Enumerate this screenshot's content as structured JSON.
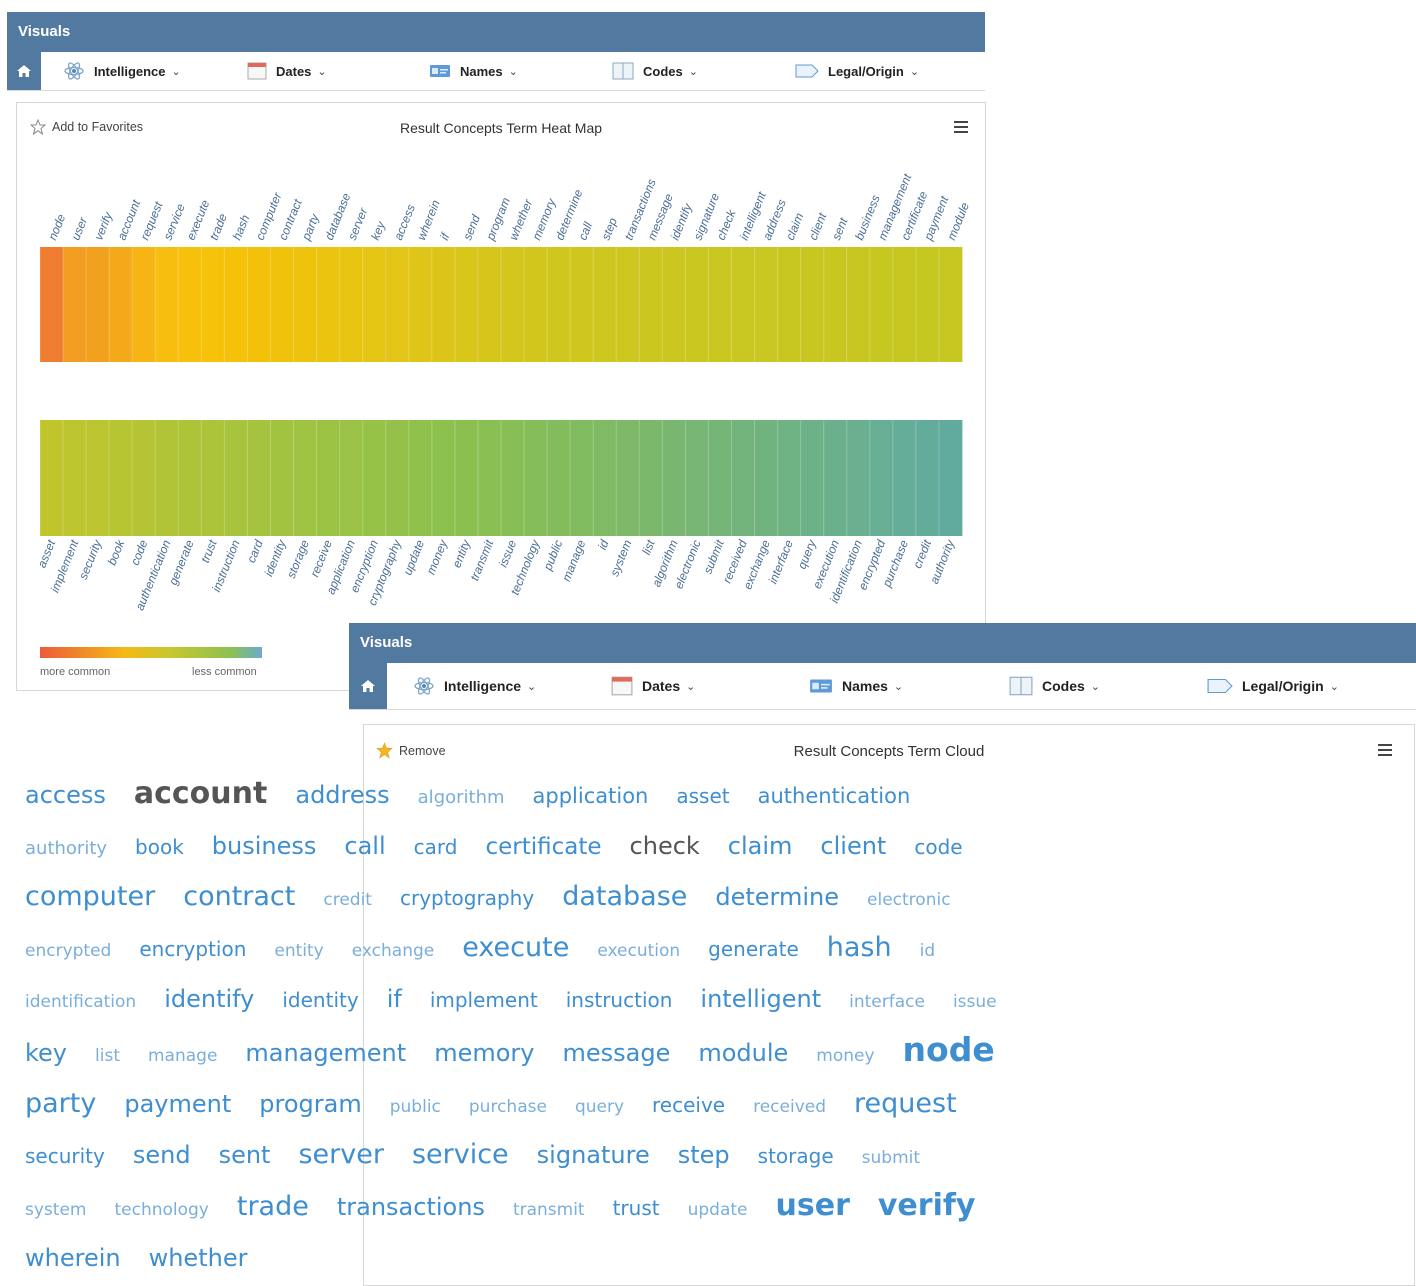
{
  "heatmap_window": {
    "title": "Visuals",
    "nav": [
      {
        "label": "Intelligence",
        "icon": "atom-icon"
      },
      {
        "label": "Dates",
        "icon": "calendar-icon"
      },
      {
        "label": "Names",
        "icon": "id-card-icon"
      },
      {
        "label": "Codes",
        "icon": "book-icon"
      },
      {
        "label": "Legal/Origin",
        "icon": "tag-icon"
      }
    ],
    "favorite_label": "Add to Favorites",
    "card_title": "Result Concepts Term Heat Map",
    "legend": {
      "left": "more common",
      "right": "less common"
    }
  },
  "chart_data": {
    "type": "heatmap",
    "title": "Result Concepts Term Heat Map",
    "rows": [
      {
        "terms": [
          "node",
          "user",
          "verify",
          "account",
          "request",
          "service",
          "execute",
          "trade",
          "hash",
          "computer",
          "contract",
          "party",
          "database",
          "server",
          "key",
          "access",
          "wherein",
          "if",
          "send",
          "program",
          "whether",
          "memory",
          "determine",
          "call",
          "step",
          "transactions",
          "message",
          "identify",
          "signature",
          "check",
          "intelligent",
          "address",
          "claim",
          "client",
          "sent",
          "business",
          "management",
          "certificate",
          "payment",
          "module"
        ],
        "colors": [
          "#ef7d31",
          "#f29d22",
          "#f2a11e",
          "#f4a91b",
          "#f6b515",
          "#f7bd0f",
          "#f7c10b",
          "#f7c20a",
          "#f6c109",
          "#f4c10a",
          "#f1c20c",
          "#eec30e",
          "#ebc410",
          "#e8c412",
          "#e5c514",
          "#e2c516",
          "#dfc517",
          "#dcc518",
          "#d9c61a",
          "#d6c61b",
          "#d4c61c",
          "#d2c61d",
          "#d0c71e",
          "#cfc71e",
          "#cec71f",
          "#cdc71f",
          "#ccc720",
          "#cbc720",
          "#cac720",
          "#cac721",
          "#c9c721",
          "#c9c721",
          "#c8c721",
          "#c8c722",
          "#c8c722",
          "#c8c722",
          "#c7c722",
          "#c7c722",
          "#c7c722",
          "#c7c722"
        ]
      },
      {
        "terms": [
          "asset",
          "implement",
          "security",
          "book",
          "code",
          "authentication",
          "generate",
          "trust",
          "instruction",
          "card",
          "identity",
          "storage",
          "receive",
          "application",
          "encryption",
          "cryptography",
          "update",
          "money",
          "entity",
          "transmit",
          "issue",
          "technology",
          "public",
          "manage",
          "id",
          "system",
          "list",
          "algorithm",
          "electronic",
          "submit",
          "received",
          "exchange",
          "interface",
          "query",
          "execution",
          "identification",
          "encrypted",
          "purchase",
          "credit",
          "authority"
        ],
        "colors": [
          "#c0c52b",
          "#bdc52e",
          "#bac530",
          "#b7c532",
          "#b4c434",
          "#b1c436",
          "#aec438",
          "#abc43a",
          "#a8c33c",
          "#a5c33e",
          "#a2c340",
          "#9fc342",
          "#9cc244",
          "#99c246",
          "#96c248",
          "#93c14a",
          "#90c14c",
          "#8dc14e",
          "#8bc050",
          "#89bf53",
          "#87be56",
          "#85bd59",
          "#83bc5c",
          "#81bb60",
          "#7fba64",
          "#7db968",
          "#7bb86c",
          "#79b770",
          "#77b674",
          "#75b578",
          "#73b47c",
          "#71b380",
          "#6fb284",
          "#6db188",
          "#6bb08c",
          "#69af90",
          "#67ae94",
          "#65ad98",
          "#63ac9b",
          "#61ab9e"
        ]
      }
    ],
    "legend": {
      "low": "more common",
      "high": "less common"
    }
  },
  "cloud_window": {
    "title": "Visuals",
    "nav": [
      {
        "label": "Intelligence",
        "icon": "atom-icon"
      },
      {
        "label": "Dates",
        "icon": "calendar-icon"
      },
      {
        "label": "Names",
        "icon": "id-card-icon"
      },
      {
        "label": "Codes",
        "icon": "book-icon"
      },
      {
        "label": "Legal/Origin",
        "icon": "tag-icon"
      }
    ],
    "favorite_label": "Remove",
    "card_title": "Result Concepts Term Cloud",
    "words": [
      {
        "text": "access",
        "size": 24,
        "color": "#3e8ed0",
        "bold": false
      },
      {
        "text": "account",
        "size": 30,
        "color": "#555555",
        "bold": true
      },
      {
        "text": "address",
        "size": 24,
        "color": "#3e8ed0",
        "bold": false
      },
      {
        "text": "algorithm",
        "size": 18,
        "color": "#7aaedb",
        "bold": false
      },
      {
        "text": "application",
        "size": 21,
        "color": "#3e8ed0",
        "bold": false
      },
      {
        "text": "asset",
        "size": 20,
        "color": "#3e8ed0",
        "bold": false
      },
      {
        "text": "authentication",
        "size": 21,
        "color": "#3e8ed0",
        "bold": false
      },
      {
        "text": "authority",
        "size": 18,
        "color": "#7aaedb",
        "bold": false
      },
      {
        "text": "book",
        "size": 20,
        "color": "#3e8ed0",
        "bold": false
      },
      {
        "text": "business",
        "size": 24,
        "color": "#3e8ed0",
        "bold": false
      },
      {
        "text": "call",
        "size": 24,
        "color": "#3e8ed0",
        "bold": false
      },
      {
        "text": "card",
        "size": 20,
        "color": "#3e8ed0",
        "bold": false
      },
      {
        "text": "certificate",
        "size": 23,
        "color": "#3e8ed0",
        "bold": false
      },
      {
        "text": "check",
        "size": 24,
        "color": "#555555",
        "bold": false
      },
      {
        "text": "claim",
        "size": 24,
        "color": "#3e8ed0",
        "bold": false
      },
      {
        "text": "client",
        "size": 24,
        "color": "#3e8ed0",
        "bold": false
      },
      {
        "text": "code",
        "size": 20,
        "color": "#3e8ed0",
        "bold": false
      },
      {
        "text": "computer",
        "size": 27,
        "color": "#3e8ed0",
        "bold": false
      },
      {
        "text": "contract",
        "size": 27,
        "color": "#3e8ed0",
        "bold": false
      },
      {
        "text": "credit",
        "size": 17,
        "color": "#7aaedb",
        "bold": false
      },
      {
        "text": "cryptography",
        "size": 20,
        "color": "#3e8ed0",
        "bold": false
      },
      {
        "text": "database",
        "size": 27,
        "color": "#3e8ed0",
        "bold": false
      },
      {
        "text": "determine",
        "size": 24,
        "color": "#3e8ed0",
        "bold": false
      },
      {
        "text": "electronic",
        "size": 17,
        "color": "#7aaedb",
        "bold": false
      },
      {
        "text": "encrypted",
        "size": 17,
        "color": "#7aaedb",
        "bold": false
      },
      {
        "text": "encryption",
        "size": 20,
        "color": "#3e8ed0",
        "bold": false
      },
      {
        "text": "entity",
        "size": 17,
        "color": "#7aaedb",
        "bold": false
      },
      {
        "text": "exchange",
        "size": 17,
        "color": "#7aaedb",
        "bold": false
      },
      {
        "text": "execute",
        "size": 27,
        "color": "#3e8ed0",
        "bold": false
      },
      {
        "text": "execution",
        "size": 17,
        "color": "#7aaedb",
        "bold": false
      },
      {
        "text": "generate",
        "size": 20,
        "color": "#3e8ed0",
        "bold": false
      },
      {
        "text": "hash",
        "size": 27,
        "color": "#3e8ed0",
        "bold": false
      },
      {
        "text": "id",
        "size": 17,
        "color": "#7aaedb",
        "bold": false
      },
      {
        "text": "identification",
        "size": 17,
        "color": "#7aaedb",
        "bold": false
      },
      {
        "text": "identify",
        "size": 24,
        "color": "#3e8ed0",
        "bold": false
      },
      {
        "text": "identity",
        "size": 20,
        "color": "#3e8ed0",
        "bold": false
      },
      {
        "text": "if",
        "size": 24,
        "color": "#3e8ed0",
        "bold": false
      },
      {
        "text": "implement",
        "size": 20,
        "color": "#3e8ed0",
        "bold": false
      },
      {
        "text": "instruction",
        "size": 20,
        "color": "#3e8ed0",
        "bold": false
      },
      {
        "text": "intelligent",
        "size": 24,
        "color": "#3e8ed0",
        "bold": false
      },
      {
        "text": "interface",
        "size": 17,
        "color": "#7aaedb",
        "bold": false
      },
      {
        "text": "issue",
        "size": 17,
        "color": "#7aaedb",
        "bold": false
      },
      {
        "text": "key",
        "size": 24,
        "color": "#3e8ed0",
        "bold": false
      },
      {
        "text": "list",
        "size": 17,
        "color": "#7aaedb",
        "bold": false
      },
      {
        "text": "manage",
        "size": 17,
        "color": "#7aaedb",
        "bold": false
      },
      {
        "text": "management",
        "size": 24,
        "color": "#3e8ed0",
        "bold": false
      },
      {
        "text": "memory",
        "size": 24,
        "color": "#3e8ed0",
        "bold": false
      },
      {
        "text": "message",
        "size": 24,
        "color": "#3e8ed0",
        "bold": false
      },
      {
        "text": "module",
        "size": 24,
        "color": "#3e8ed0",
        "bold": false
      },
      {
        "text": "money",
        "size": 17,
        "color": "#7aaedb",
        "bold": false
      },
      {
        "text": "node",
        "size": 33,
        "color": "#3e8ed0",
        "bold": true
      },
      {
        "text": "party",
        "size": 27,
        "color": "#3e8ed0",
        "bold": false
      },
      {
        "text": "payment",
        "size": 24,
        "color": "#3e8ed0",
        "bold": false
      },
      {
        "text": "program",
        "size": 24,
        "color": "#3e8ed0",
        "bold": false
      },
      {
        "text": "public",
        "size": 17,
        "color": "#7aaedb",
        "bold": false
      },
      {
        "text": "purchase",
        "size": 17,
        "color": "#7aaedb",
        "bold": false
      },
      {
        "text": "query",
        "size": 17,
        "color": "#7aaedb",
        "bold": false
      },
      {
        "text": "receive",
        "size": 20,
        "color": "#3e8ed0",
        "bold": false
      },
      {
        "text": "received",
        "size": 17,
        "color": "#7aaedb",
        "bold": false
      },
      {
        "text": "request",
        "size": 27,
        "color": "#3e8ed0",
        "bold": false
      },
      {
        "text": "security",
        "size": 20,
        "color": "#3e8ed0",
        "bold": false
      },
      {
        "text": "send",
        "size": 24,
        "color": "#3e8ed0",
        "bold": false
      },
      {
        "text": "sent",
        "size": 24,
        "color": "#3e8ed0",
        "bold": false
      },
      {
        "text": "server",
        "size": 27,
        "color": "#3e8ed0",
        "bold": false
      },
      {
        "text": "service",
        "size": 27,
        "color": "#3e8ed0",
        "bold": false
      },
      {
        "text": "signature",
        "size": 24,
        "color": "#3e8ed0",
        "bold": false
      },
      {
        "text": "step",
        "size": 24,
        "color": "#3e8ed0",
        "bold": false
      },
      {
        "text": "storage",
        "size": 20,
        "color": "#3e8ed0",
        "bold": false
      },
      {
        "text": "submit",
        "size": 17,
        "color": "#7aaedb",
        "bold": false
      },
      {
        "text": "system",
        "size": 17,
        "color": "#7aaedb",
        "bold": false
      },
      {
        "text": "technology",
        "size": 17,
        "color": "#7aaedb",
        "bold": false
      },
      {
        "text": "trade",
        "size": 27,
        "color": "#3e8ed0",
        "bold": false
      },
      {
        "text": "transactions",
        "size": 24,
        "color": "#3e8ed0",
        "bold": false
      },
      {
        "text": "transmit",
        "size": 17,
        "color": "#7aaedb",
        "bold": false
      },
      {
        "text": "trust",
        "size": 20,
        "color": "#3e8ed0",
        "bold": false
      },
      {
        "text": "update",
        "size": 17,
        "color": "#7aaedb",
        "bold": false
      },
      {
        "text": "user",
        "size": 30,
        "color": "#3e8ed0",
        "bold": true
      },
      {
        "text": "verify",
        "size": 30,
        "color": "#3e8ed0",
        "bold": true
      },
      {
        "text": "wherein",
        "size": 24,
        "color": "#3e8ed0",
        "bold": false
      },
      {
        "text": "whether",
        "size": 24,
        "color": "#3e8ed0",
        "bold": false
      }
    ]
  },
  "colors": {
    "titlebar": "#52799f",
    "accent": "#3e8ed0",
    "star_filled": "#f5b623"
  }
}
